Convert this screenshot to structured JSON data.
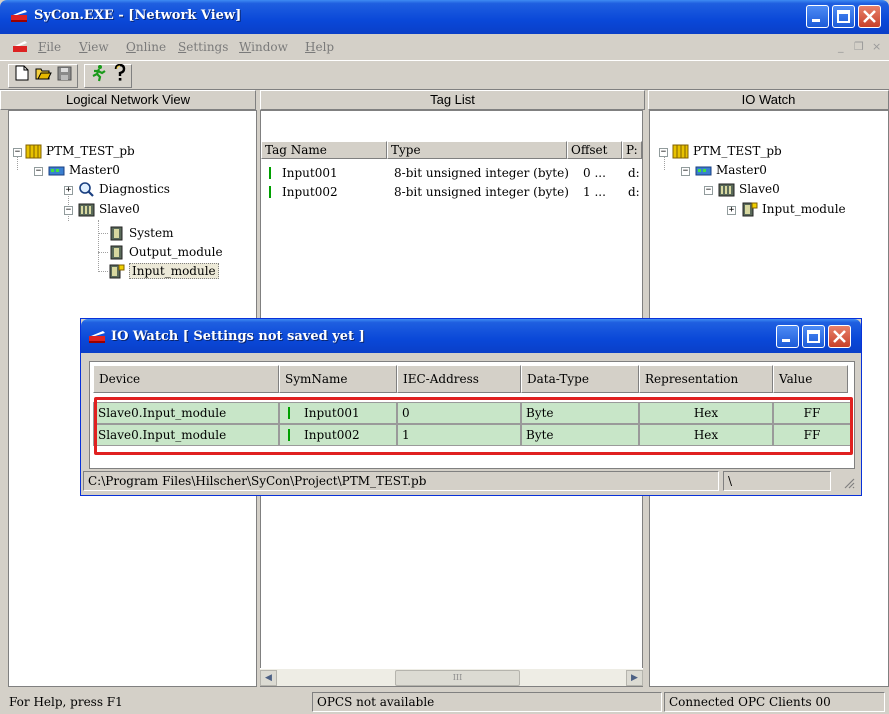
{
  "window": {
    "title": "SyCon.EXE - [Network View]",
    "controls": [
      "minimize-icon",
      "maximize-icon",
      "close-icon"
    ]
  },
  "menu": {
    "items": [
      {
        "label": "File",
        "accel": "F"
      },
      {
        "label": "View",
        "accel": "V"
      },
      {
        "label": "Online",
        "accel": "O"
      },
      {
        "label": "Settings",
        "accel": "S"
      },
      {
        "label": "Window",
        "accel": "W"
      },
      {
        "label": "Help",
        "accel": "H"
      }
    ],
    "mdi_controls": [
      "_",
      "❒",
      "×"
    ]
  },
  "toolbar": {
    "buttons": [
      "new-file-icon",
      "open-folder-icon",
      "save-icon",
      "running-man-icon",
      "help-icon"
    ]
  },
  "panes": {
    "logical": {
      "header": "Logical Network View",
      "tree": {
        "root": "PTM_TEST_pb",
        "master": "Master0",
        "diagnostics": "Diagnostics",
        "slave": "Slave0",
        "system": "System",
        "output": "Output_module",
        "input": "Input_module"
      }
    },
    "taglist": {
      "header": "Tag List",
      "columns": [
        "Tag Name",
        "Type",
        "Offset",
        "P:"
      ],
      "rows": [
        {
          "name": "Input001",
          "type": "8-bit unsigned integer (byte)",
          "offset": "0 ...",
          "p": "d:"
        },
        {
          "name": "Input002",
          "type": "8-bit unsigned integer (byte)",
          "offset": "1 ...",
          "p": "d:"
        }
      ]
    },
    "iowatch": {
      "header": "IO Watch",
      "tree": {
        "root": "PTM_TEST_pb",
        "master": "Master0",
        "slave": "Slave0",
        "input": "Input_module"
      }
    }
  },
  "dialog": {
    "title": "IO Watch [ Settings not saved yet ]",
    "columns": [
      "Device",
      "SymName",
      "IEC-Address",
      "Data-Type",
      "Representation",
      "Value"
    ],
    "rows": [
      {
        "device": "Slave0.Input_module",
        "symname": "Input001",
        "iec": "0",
        "dtype": "Byte",
        "repr": "Hex",
        "value": "FF"
      },
      {
        "device": "Slave0.Input_module",
        "symname": "Input002",
        "iec": "1",
        "dtype": "Byte",
        "repr": "Hex",
        "value": "FF"
      }
    ],
    "status_path": "C:\\Program Files\\Hilscher\\SyCon\\Project\\PTM_TEST.pb",
    "status_extra": "\\",
    "row_color": "#c8e6c8",
    "highlight_color": "#e02020"
  },
  "statusbar": {
    "help": "For Help, press F1",
    "opcs": "OPCS not available",
    "clients": "Connected OPC Clients 00"
  }
}
